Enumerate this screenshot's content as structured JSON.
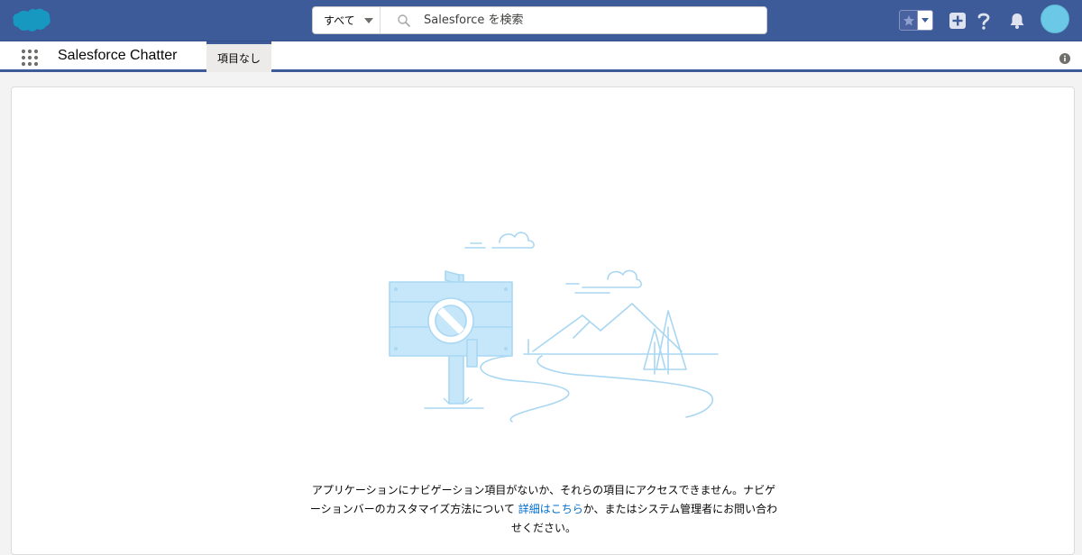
{
  "header": {
    "search": {
      "scope_label": "すべて",
      "placeholder": "Salesforce を検索"
    },
    "icons": [
      "salesforce-logo",
      "search-icon",
      "favorites-star-icon",
      "favorites-menu-caret-icon",
      "global-actions-plus-icon",
      "help-icon",
      "notifications-bell-icon",
      "user-avatar"
    ]
  },
  "nav": {
    "app_name": "Salesforce Chatter",
    "tab_label": "項目なし"
  },
  "main": {
    "message_part1": "アプリケーションにナビゲーション項目がないか、それらの項目にアクセスできません。ナビゲーションバーのカスタマイズ方法について ",
    "link_label": "詳細はこちら",
    "message_part2": "か、またはシステム管理者にお問い合わせください。"
  },
  "colors": {
    "header_bg": "#3d5a99",
    "link": "#006dcc",
    "avatar": "#6bc8e6",
    "illustration_stroke": "#a9d7f2",
    "illustration_fill": "#c6e7fa"
  }
}
